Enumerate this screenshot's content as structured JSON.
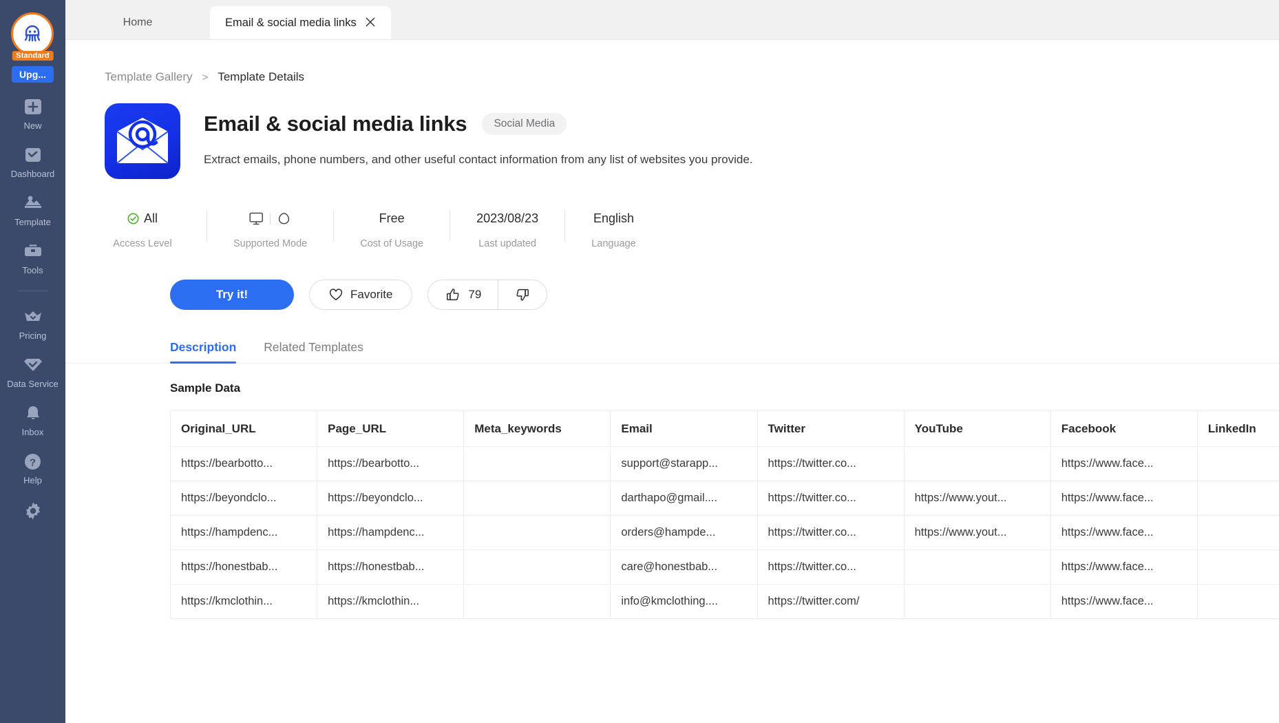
{
  "sidebar": {
    "avatar_name": "user-avatar",
    "plan_badge": "Standard",
    "upgrade_label": "Upg...",
    "items": [
      {
        "label": "New",
        "icon": "plus-icon"
      },
      {
        "label": "Dashboard",
        "icon": "dashboard-icon"
      },
      {
        "label": "Template",
        "icon": "template-icon"
      },
      {
        "label": "Tools",
        "icon": "toolbox-icon"
      },
      {
        "label": "Pricing",
        "icon": "crown-icon"
      },
      {
        "label": "Data Service",
        "icon": "diamond-check-icon"
      },
      {
        "label": "Inbox",
        "icon": "bell-icon"
      },
      {
        "label": "Help",
        "icon": "question-circle-icon"
      }
    ],
    "settings_icon": "gear-icon"
  },
  "titlebar": {
    "tabs": [
      {
        "label": "Home",
        "active": false,
        "closable": false
      },
      {
        "label": "Email & social media links",
        "active": true,
        "closable": true
      }
    ],
    "minimize_icon": "minimize-icon",
    "restore_icon": "restore-icon"
  },
  "breadcrumb": {
    "root": "Template Gallery",
    "separator": ">",
    "current": "Template Details"
  },
  "template": {
    "icon_name": "email-at-envelope-icon",
    "title": "Email & social media links",
    "category": "Social Media",
    "description": "Extract emails, phone numbers, and other useful contact information from any list of websites you provide."
  },
  "meta": [
    {
      "value": "All",
      "label": "Access Level",
      "icon": "check-circle-icon"
    },
    {
      "value": "",
      "label": "Supported Mode",
      "icon": "monitor-icon|cloud-icon"
    },
    {
      "value": "Free",
      "label": "Cost of Usage",
      "icon": ""
    },
    {
      "value": "2023/08/23",
      "label": "Last updated",
      "icon": ""
    },
    {
      "value": "English",
      "label": "Language",
      "icon": ""
    }
  ],
  "actions": {
    "try_label": "Try it!",
    "favorite_label": "Favorite",
    "favorite_icon": "heart-icon",
    "thumbs_up_icon": "thumbs-up-icon",
    "thumbs_up_count": "79",
    "thumbs_down_icon": "thumbs-down-icon",
    "pointer_icon": "red-arrow-annotation"
  },
  "detail_tabs": [
    {
      "label": "Description",
      "active": true
    },
    {
      "label": "Related Templates",
      "active": false
    }
  ],
  "sample": {
    "heading": "Sample Data",
    "columns": [
      "Original_URL",
      "Page_URL",
      "Meta_keywords",
      "Email",
      "Twitter",
      "YouTube",
      "Facebook",
      "LinkedIn"
    ],
    "rows": [
      [
        "https://bearbotto...",
        "https://bearbotto...",
        "",
        "support@starapp...",
        "https://twitter.co...",
        "",
        "https://www.face...",
        ""
      ],
      [
        "https://beyondclo...",
        "https://beyondclo...",
        "",
        "darthapo@gmail....",
        "https://twitter.co...",
        "https://www.yout...",
        "https://www.face...",
        ""
      ],
      [
        "https://hampdenc...",
        "https://hampdenc...",
        "",
        "orders@hampde...",
        "https://twitter.co...",
        "https://www.yout...",
        "https://www.face...",
        ""
      ],
      [
        "https://honestbab...",
        "https://honestbab...",
        "",
        "care@honestbab...",
        "https://twitter.co...",
        "",
        "https://www.face...",
        ""
      ],
      [
        "https://kmclothin...",
        "https://kmclothin...",
        "",
        "info@kmclothing....",
        "https://twitter.com/",
        "",
        "https://www.face...",
        ""
      ]
    ]
  },
  "help_fab": {
    "icon": "question-circle-icon"
  },
  "colors": {
    "sidebar_bg": "#3b4a6b",
    "accent": "#2c6ef2",
    "badge_orange": "#f07b1d",
    "arrow_red": "#ee1c25",
    "icon_blue": "#1430e8",
    "check_green": "#4caf2a"
  }
}
